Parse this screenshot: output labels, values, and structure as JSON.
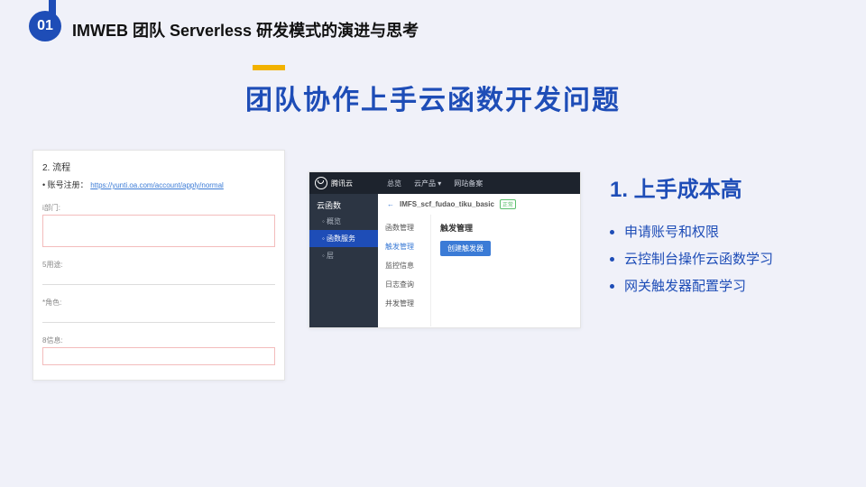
{
  "header": {
    "slide_no": "01",
    "title": "IMWEB 团队 Serverless 研发模式的演进与思考"
  },
  "main_title": "团队协作上手云函数开发问题",
  "form_panel": {
    "section": "2. 流程",
    "bullet_label": "账号注册：",
    "link": "https://yunti.oa.com/account/apply/normal",
    "field1": "i部门:",
    "field2": "5用途:",
    "field3": "*角色:",
    "field4": "8信息:"
  },
  "console": {
    "brand": "腾讯云",
    "topnav": [
      "总览",
      "云产品 ▾",
      "网站备案"
    ],
    "side_title": "云函数",
    "side_items": [
      {
        "label": "概览",
        "selected": false
      },
      {
        "label": "函数服务",
        "selected": true
      },
      {
        "label": "层",
        "selected": false
      }
    ],
    "crumb_back": "←",
    "crumb_name": "IMFS_scf_fudao_tiku_basic",
    "crumb_tag": "正常",
    "menu": [
      "函数管理",
      "触发管理",
      "监控信息",
      "日志查询",
      "并发管理"
    ],
    "menu_selected_index": 1,
    "main_heading": "触发管理",
    "main_button": "创建触发器"
  },
  "right": {
    "heading": "1. 上手成本高",
    "items": [
      "申请账号和权限",
      "云控制台操作云函数学习",
      "网关触发器配置学习"
    ]
  }
}
